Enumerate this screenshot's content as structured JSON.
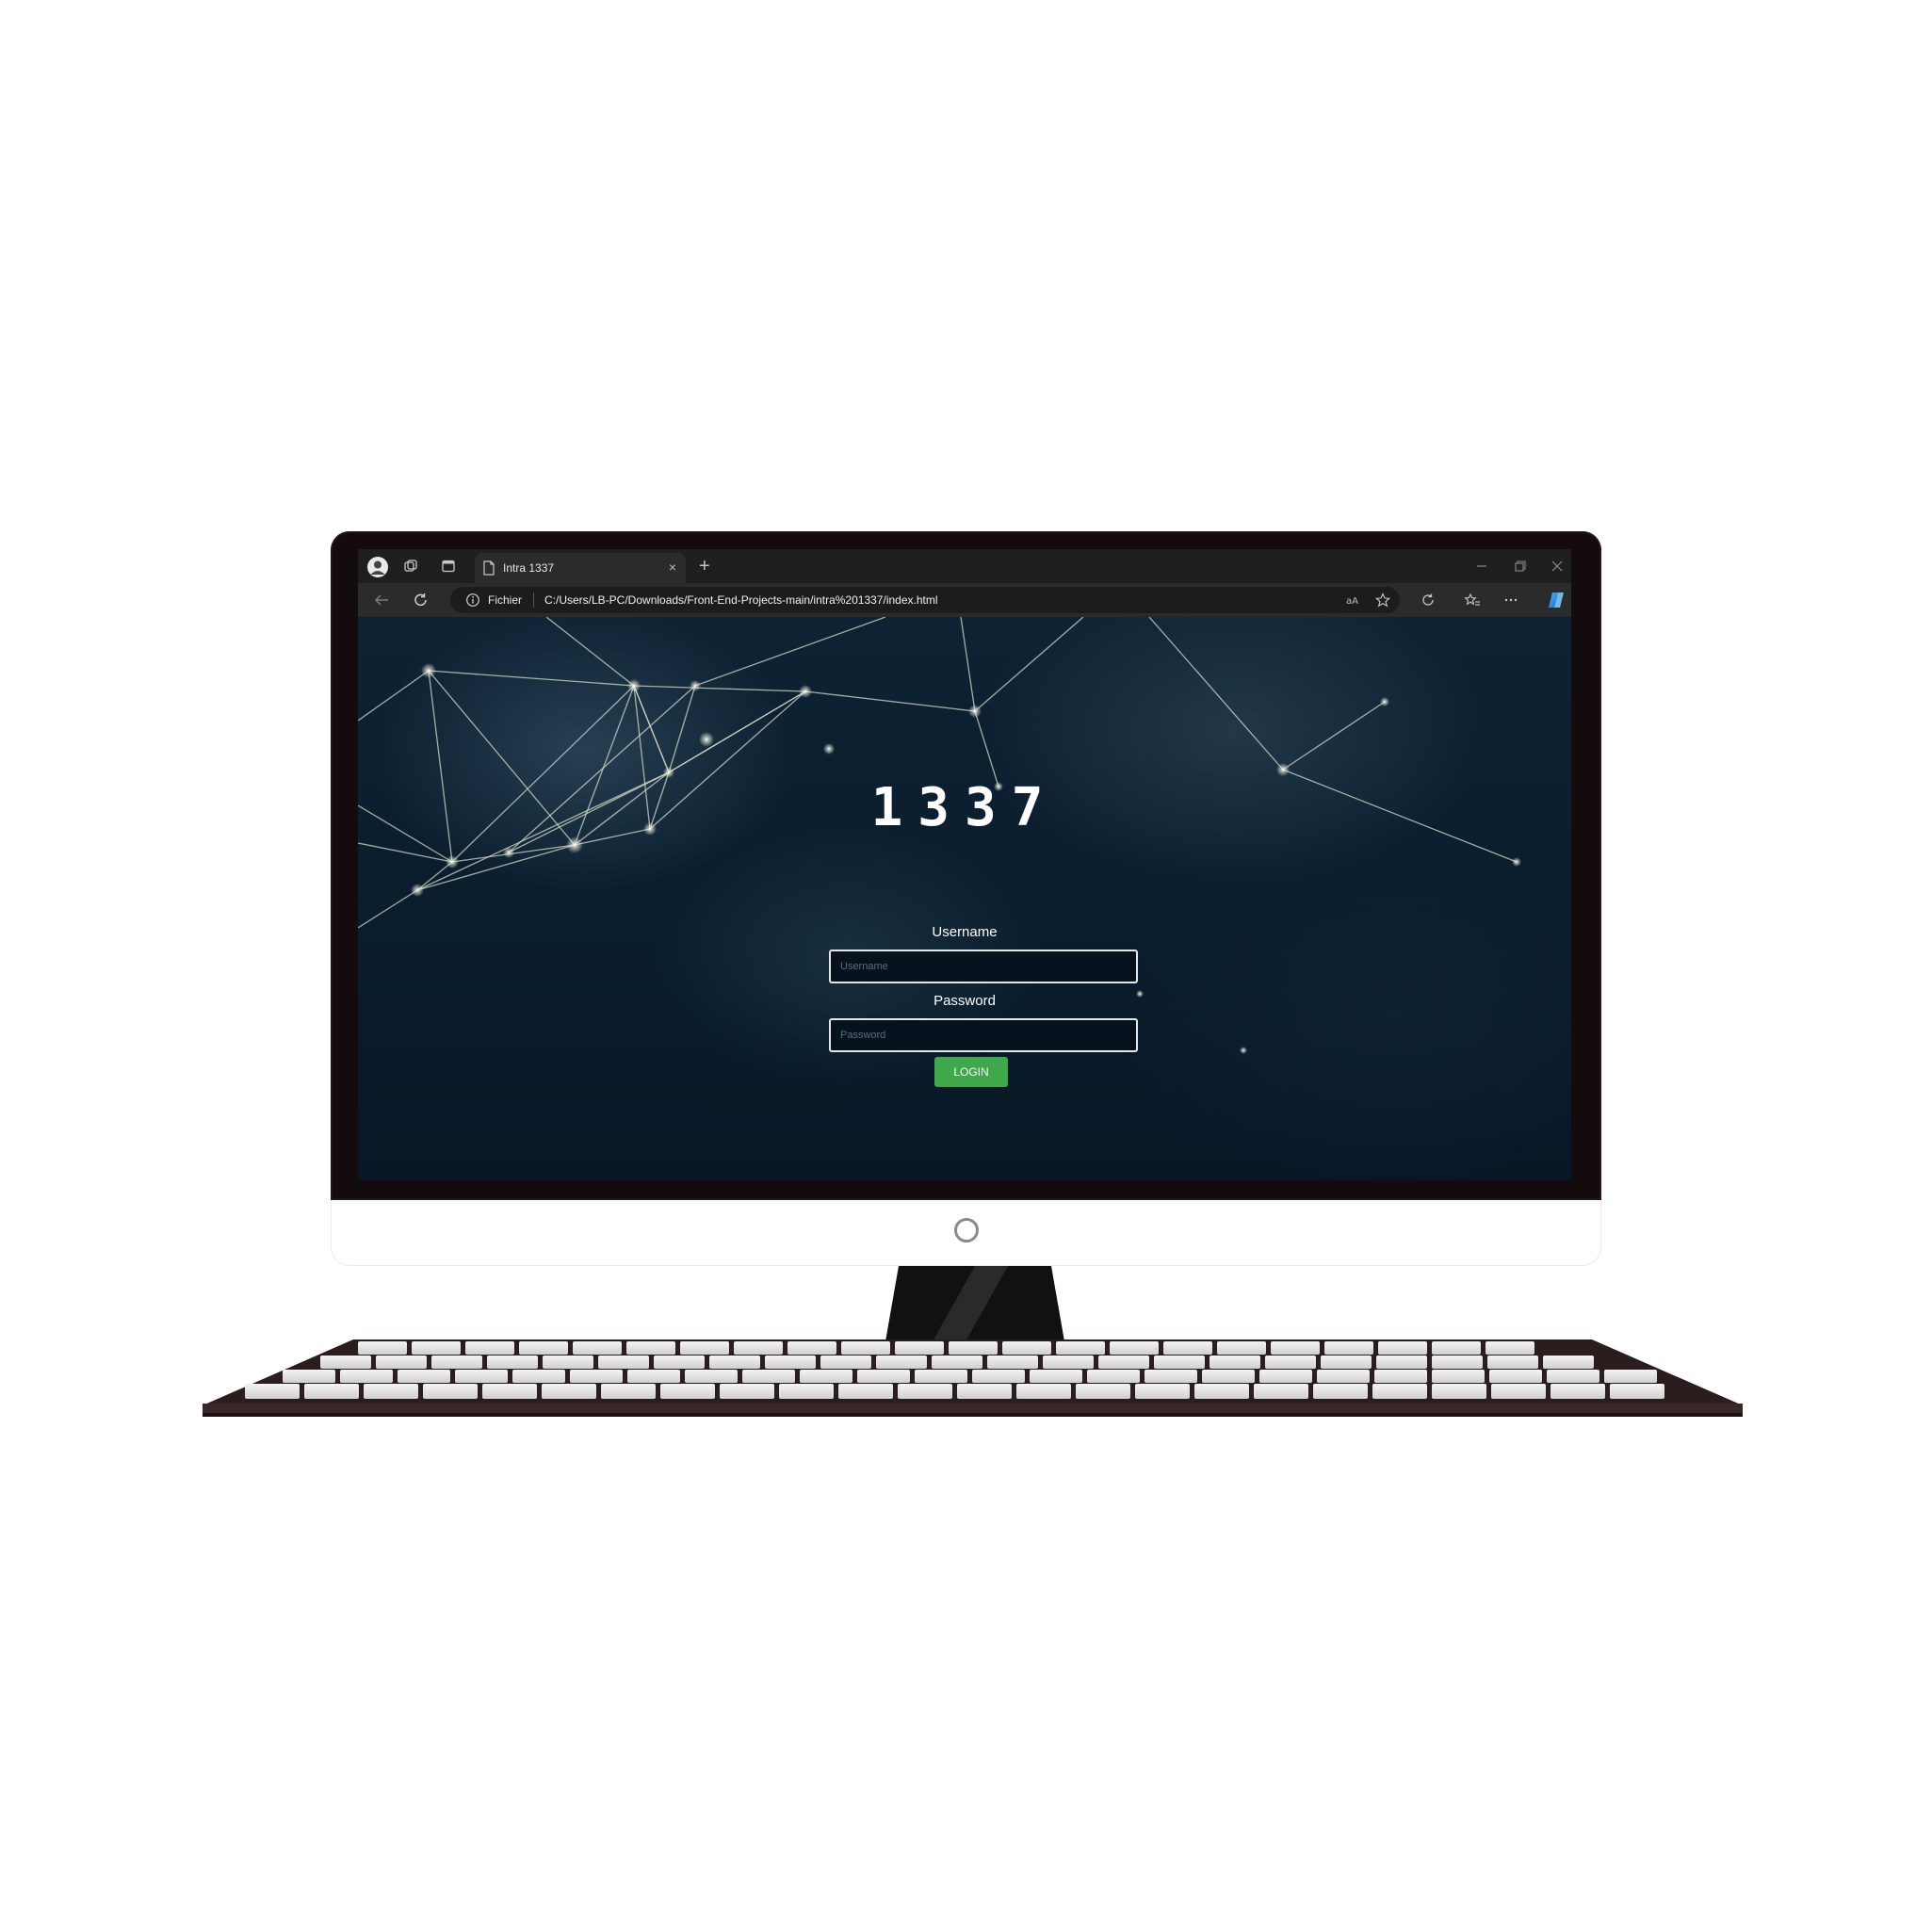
{
  "browser": {
    "tab_title": "Intra 1337",
    "new_tab_glyph": "+",
    "close_tab_glyph": "×",
    "address_prefix": "Fichier",
    "address_url": "C:/Users/LB-PC/Downloads/Front-End-Projects-main/intra%201337/index.html",
    "icons": [
      "profile-icon",
      "workspaces-icon",
      "tab-actions-icon",
      "page-icon",
      "back-icon",
      "refresh-icon",
      "info-icon",
      "read-aloud-icon",
      "favorite-icon",
      "extensions-icon",
      "favorites-icon",
      "more-icon",
      "copilot-icon",
      "minimize-icon",
      "restore-icon",
      "close-window-icon"
    ]
  },
  "page": {
    "logo": "1337",
    "username_label": "Username",
    "username_placeholder": "Username",
    "password_label": "Password",
    "password_placeholder": "Password",
    "login_label": "LOGIN"
  },
  "colors": {
    "login_button": "#3fa84a",
    "page_background": "#0a1d2d",
    "bezel": "#140b0c"
  }
}
